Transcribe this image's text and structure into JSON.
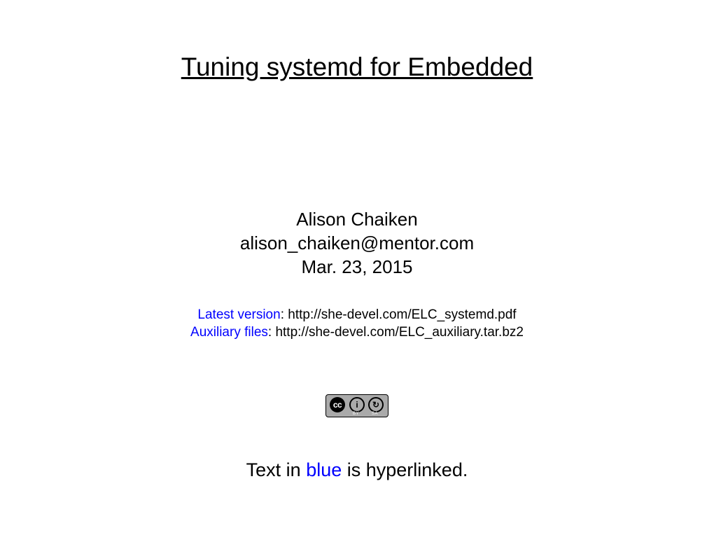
{
  "title": "Tuning systemd for Embedded",
  "author": {
    "name": "Alison Chaiken",
    "email": "alison_chaiken@mentor.com",
    "date": "Mar. 23, 2015"
  },
  "links": {
    "latest_label": "Latest version",
    "latest_url": ": http://she-devel.com/ELC_systemd.pdf",
    "aux_label": "Auxiliary files",
    "aux_url": ": http://she-devel.com/ELC_auxiliary.tar.bz2"
  },
  "license": {
    "cc": "cc",
    "by_symbol": "i",
    "sa_symbol": "↻",
    "by_label": "BY",
    "sa_label": "SA"
  },
  "footer": {
    "prefix": "Text in ",
    "blue": "blue",
    "suffix": " is hyperlinked."
  }
}
